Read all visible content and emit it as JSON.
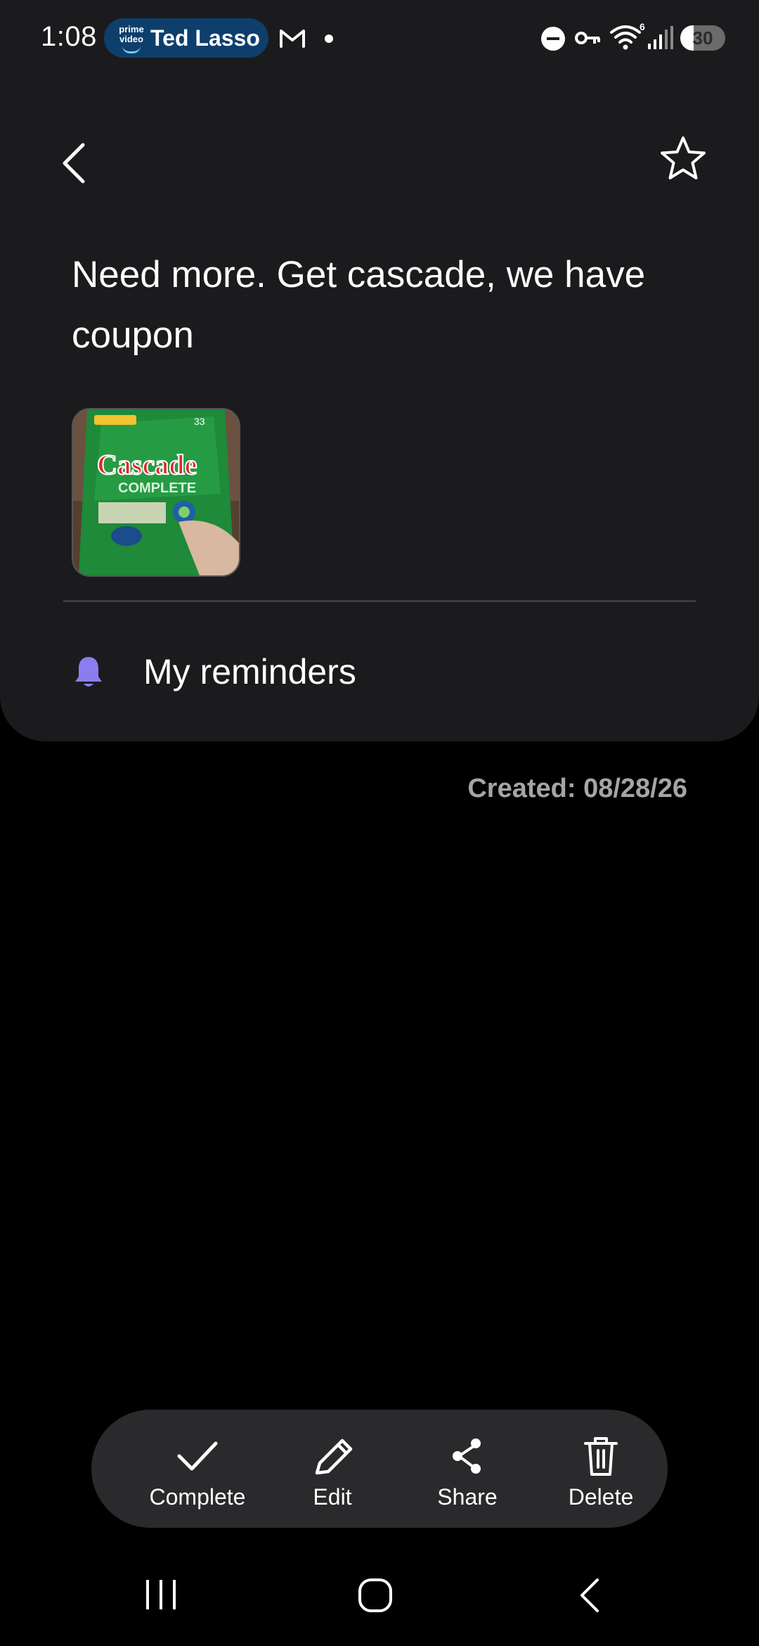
{
  "status_bar": {
    "time": "1:08",
    "media_brand_line1": "prime",
    "media_brand_line2": "video",
    "media_title": "Ted Lasso",
    "wifi_badge": "6",
    "battery_level": "30",
    "battery_fraction": 0.3
  },
  "note": {
    "text": "Need more. Get cascade, we have coupon",
    "attachment": {
      "brand": "Cascade",
      "subbrand": "COMPLETE",
      "count": "33"
    },
    "reminder_list": "My reminders",
    "created": "Created: 08/28/26"
  },
  "actions": [
    {
      "label": "Complete",
      "icon": "check-icon"
    },
    {
      "label": "Edit",
      "icon": "pencil-icon"
    },
    {
      "label": "Share",
      "icon": "share-icon"
    },
    {
      "label": "Delete",
      "icon": "trash-icon"
    }
  ],
  "colors": {
    "background": "#000000",
    "card": "#1b1b1d",
    "action_bar": "#2a2a2c",
    "bell_accent": "#8c7cf0",
    "muted_text": "#a5a5a8",
    "media_pill": "#0e3f6c"
  }
}
